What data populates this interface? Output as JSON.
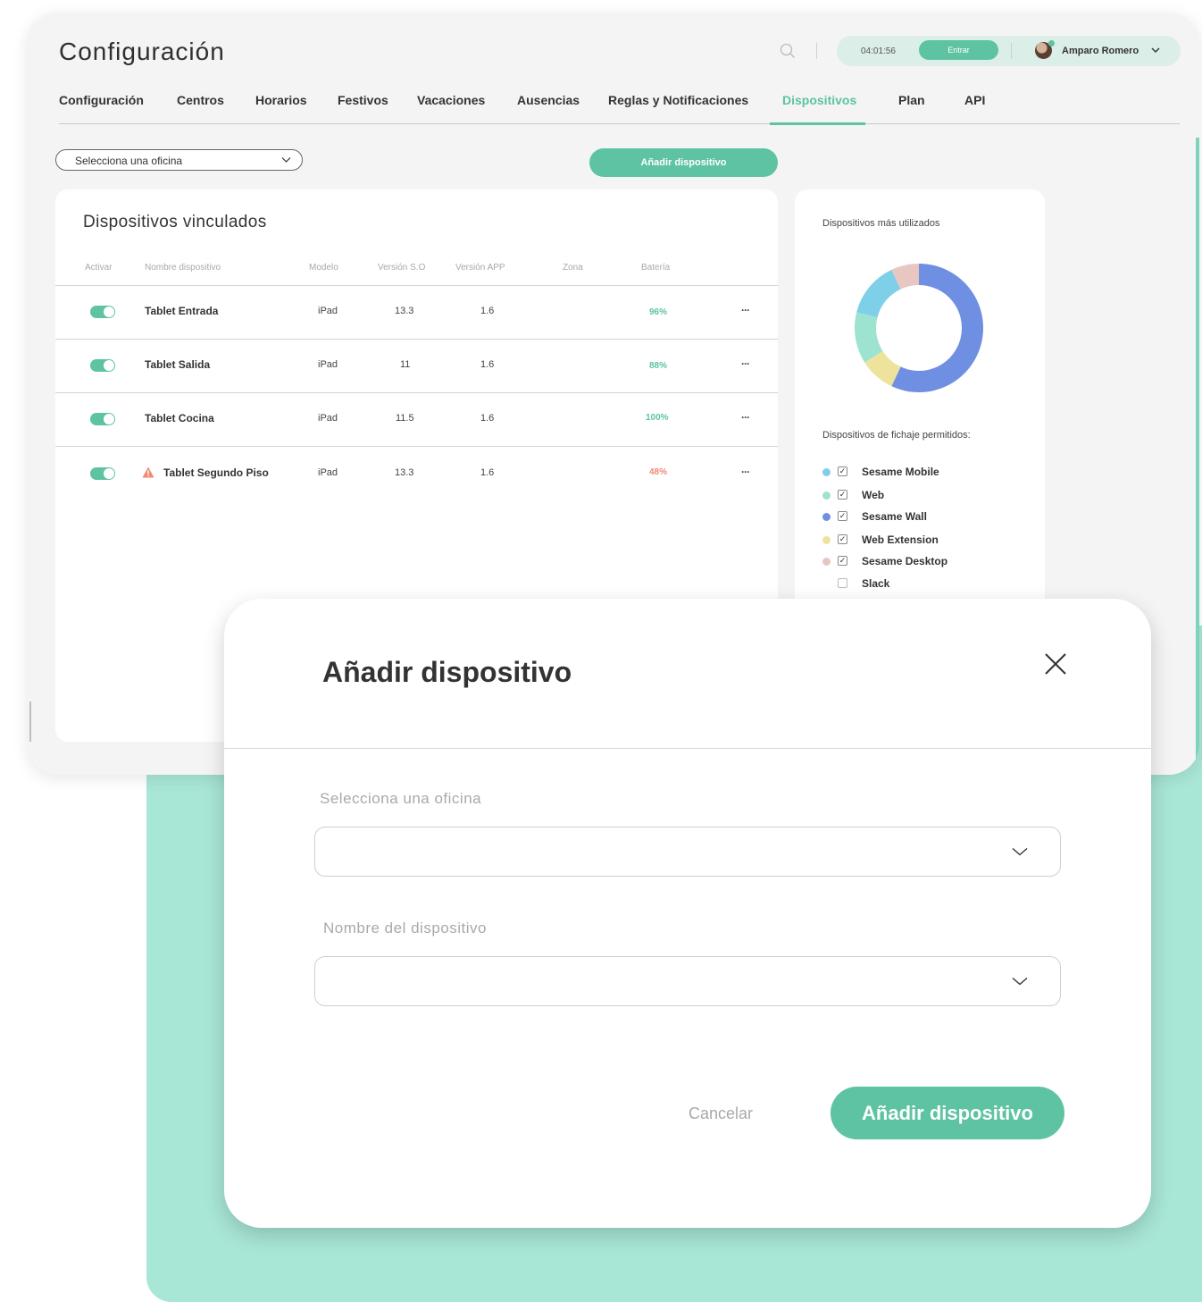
{
  "page_title": "Configuración",
  "header": {
    "clock_time": "04:01:56",
    "entrar_label": "Entrar",
    "user_name": "Amparo Romero"
  },
  "tabs": [
    {
      "label": "Configuración",
      "active": false
    },
    {
      "label": "Centros",
      "active": false
    },
    {
      "label": "Horarios",
      "active": false
    },
    {
      "label": "Festivos",
      "active": false
    },
    {
      "label": "Vacaciones",
      "active": false
    },
    {
      "label": "Ausencias",
      "active": false
    },
    {
      "label": "Reglas y Notificaciones",
      "active": false
    },
    {
      "label": "Dispositivos",
      "active": true
    },
    {
      "label": "Plan",
      "active": false
    },
    {
      "label": "API",
      "active": false
    }
  ],
  "toolbar": {
    "office_select_value": "Selecciona una oficina",
    "add_device_label": "Añadir dispositivo"
  },
  "devices_card": {
    "title": "Dispositivos vinculados",
    "columns": [
      "Activar",
      "Nombre dispositivo",
      "Modelo",
      "Versión S.O",
      "Versión APP",
      "Zona",
      "Batería"
    ],
    "rows": [
      {
        "active": true,
        "warning": false,
        "name": "Tablet Entrada",
        "model": "iPad",
        "os": "13.3",
        "app": "1.6",
        "zone": "",
        "battery": "96%",
        "battery_color": "#5ec3a2"
      },
      {
        "active": true,
        "warning": false,
        "name": "Tablet Salida",
        "model": "iPad",
        "os": "11",
        "app": "1.6",
        "zone": "",
        "battery": "88%",
        "battery_color": "#5ec3a2"
      },
      {
        "active": true,
        "warning": false,
        "name": "Tablet Cocina",
        "model": "iPad",
        "os": "11.5",
        "app": "1.6",
        "zone": "",
        "battery": "100%",
        "battery_color": "#5ec3a2"
      },
      {
        "active": true,
        "warning": true,
        "name": "Tablet Segundo Piso",
        "model": "iPad",
        "os": "13.3",
        "app": "1.6",
        "zone": "",
        "battery": "48%",
        "battery_color": "#f08a73"
      }
    ],
    "row_menu_label": "···"
  },
  "side_card": {
    "title": "Dispositivos más utilizados",
    "allowed_title": "Dispositivos de fichaje permitidos:",
    "items": [
      {
        "label": "Sesame Mobile",
        "color": "#7ecfe8",
        "checked": true
      },
      {
        "label": "Web",
        "color": "#9de3d0",
        "checked": true
      },
      {
        "label": "Sesame Wall",
        "color": "#6f8fe3",
        "checked": true
      },
      {
        "label": "Web Extension",
        "color": "#ede39c",
        "checked": true
      },
      {
        "label": "Sesame Desktop",
        "color": "#e8c6c2",
        "checked": true
      },
      {
        "label": "Slack",
        "color": "",
        "checked": false
      }
    ]
  },
  "chart_data": {
    "type": "pie",
    "title": "Dispositivos más utilizados",
    "slices": [
      {
        "label": "Sesame Wall",
        "value": 57,
        "color": "#6f8fe3"
      },
      {
        "label": "Web Extension",
        "value": 9,
        "color": "#ede39c"
      },
      {
        "label": "Web",
        "value": 13,
        "color": "#9de3d0"
      },
      {
        "label": "Sesame Mobile",
        "value": 14,
        "color": "#7ecfe8"
      },
      {
        "label": "Sesame Desktop",
        "value": 7,
        "color": "#e8c6c2"
      }
    ]
  },
  "modal": {
    "title": "Añadir dispositivo",
    "office_label": "Selecciona una oficina",
    "office_value": "",
    "name_label": "Nombre del dispositivo",
    "name_value": "",
    "cancel_label": "Cancelar",
    "submit_label": "Añadir dispositivo"
  },
  "colors": {
    "accent": "#5ec3a2",
    "mint_background": "#a8e6d6",
    "battery_low": "#f08a73"
  }
}
